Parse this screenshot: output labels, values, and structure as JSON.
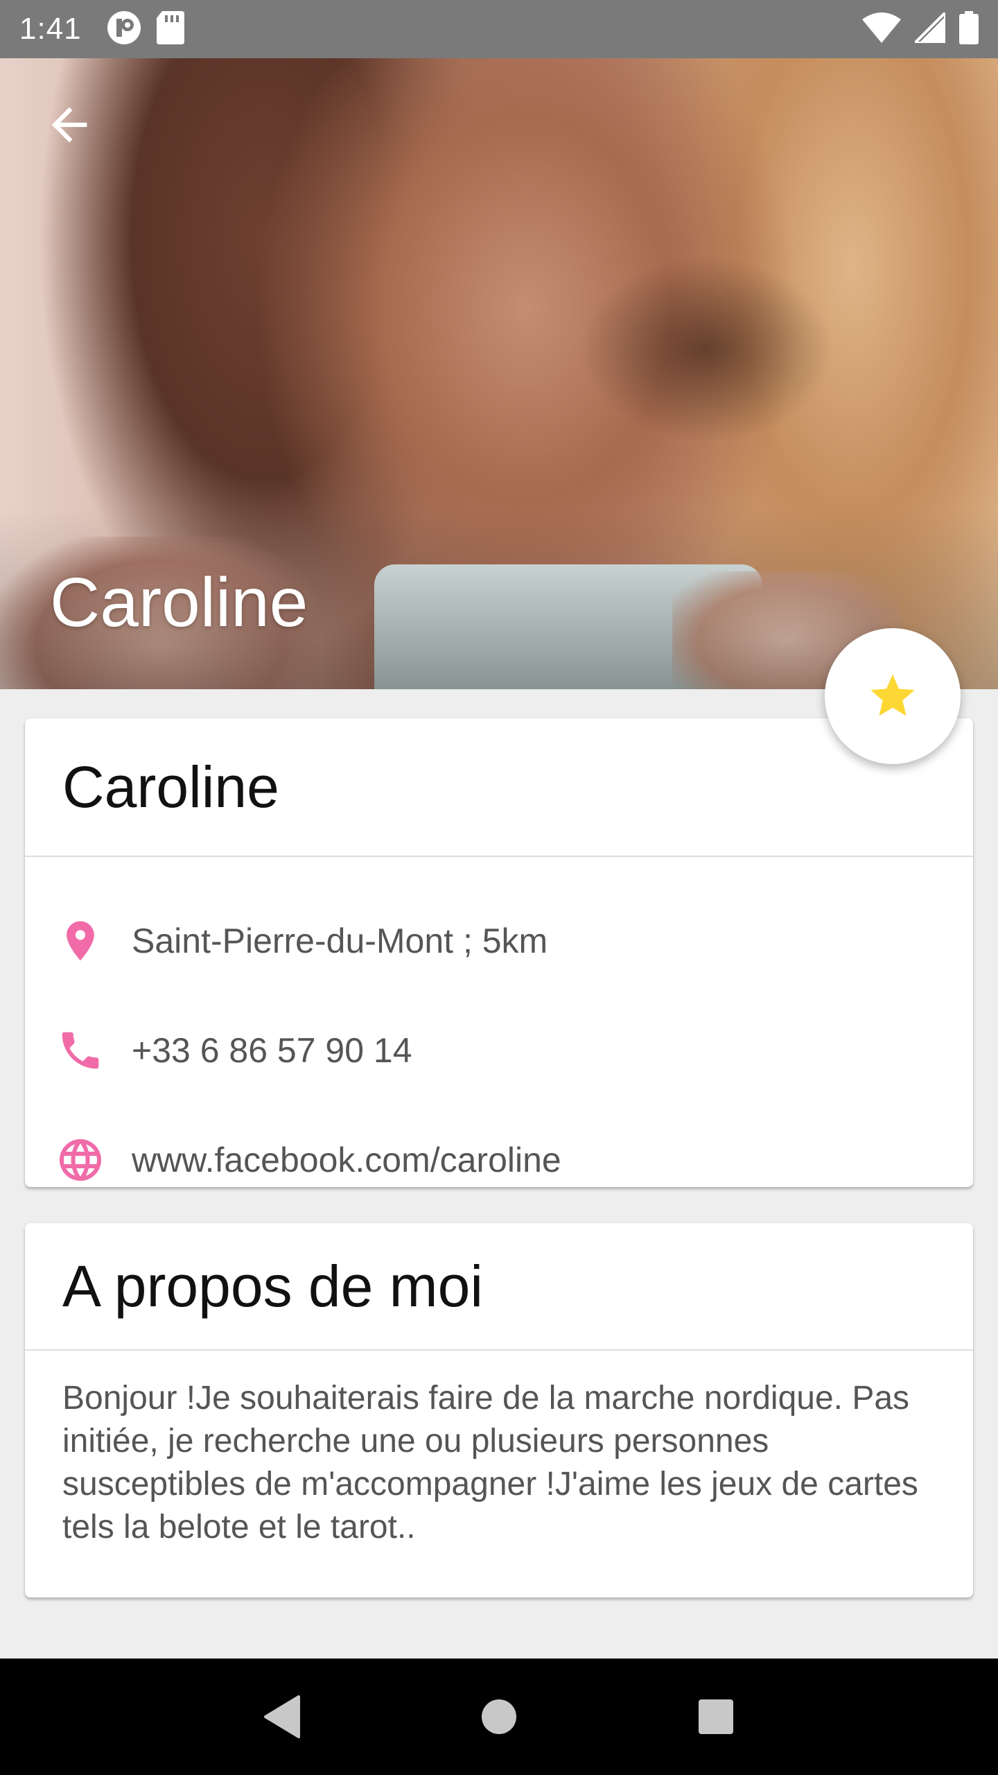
{
  "status_bar": {
    "time": "1:41",
    "left_icons": [
      "notification-app-icon",
      "sd-card-icon"
    ],
    "right_icons": [
      "wifi-icon",
      "cellular-signal-icon",
      "battery-icon"
    ]
  },
  "hero": {
    "title": "Caroline",
    "back_icon": "arrow-back-icon"
  },
  "fab": {
    "icon": "star-icon",
    "star_color": "#FDD835"
  },
  "info_card": {
    "title": "Caroline",
    "location": "Saint-Pierre-du-Mont ; 5km",
    "phone": "+33 6 86 57 90 14",
    "website": "www.facebook.com/caroline",
    "icon_color": "#F06BA7"
  },
  "about_card": {
    "title": "A propos de moi",
    "text": "Bonjour !Je souhaiterais faire de la marche nordique. Pas initiée, je recherche une ou plusieurs personnes susceptibles de m'accompagner !J'aime les jeux de cartes tels la belote et le tarot.."
  },
  "nav_bar": {
    "buttons": [
      "back-triangle-icon",
      "home-circle-icon",
      "recents-square-icon"
    ]
  }
}
